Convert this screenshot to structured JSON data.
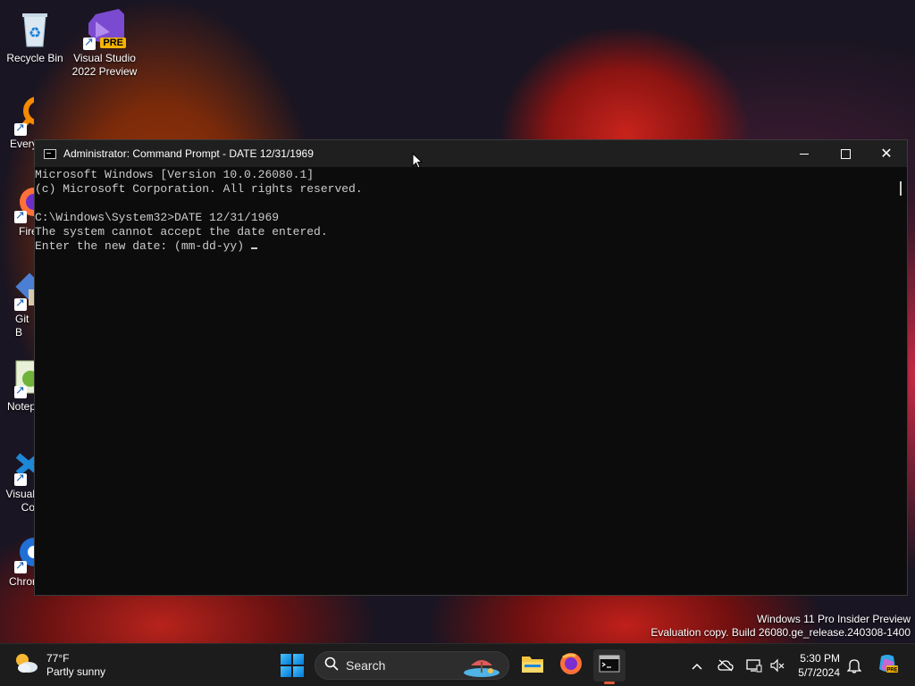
{
  "desktop": {
    "icons": [
      {
        "label": "Recycle Bin"
      },
      {
        "label": "Visual Studio 2022 Preview",
        "badge": "PRE"
      },
      {
        "label": "Every"
      },
      {
        "label": "Fire"
      },
      {
        "label": "Git B"
      },
      {
        "label": "Notep"
      },
      {
        "label": "Visual\nCo"
      },
      {
        "label": "Chrom"
      }
    ]
  },
  "window": {
    "title": "Administrator: Command Prompt - DATE  12/31/1969",
    "icon": "console-icon",
    "lines": [
      "Microsoft Windows [Version 10.0.26080.1]",
      "(c) Microsoft Corporation. All rights reserved.",
      "",
      "C:\\Windows\\System32>DATE 12/31/1969",
      "The system cannot accept the date entered.",
      "Enter the new date: (mm-dd-yy)"
    ]
  },
  "watermark": {
    "line1": "Windows 11 Pro Insider Preview",
    "line2": "Evaluation copy. Build 26080.ge_release.240308-1400"
  },
  "taskbar": {
    "weather": {
      "temp": "77°F",
      "condition": "Partly sunny",
      "icon": "partly-sunny-icon"
    },
    "search": {
      "label": "Search"
    },
    "apps": [
      {
        "name": "File Explorer",
        "icon": "folder-icon"
      },
      {
        "name": "Firefox",
        "icon": "firefox-icon"
      },
      {
        "name": "Terminal",
        "icon": "terminal-icon",
        "active": true
      }
    ],
    "clock": {
      "time": "5:30 PM",
      "date": "5/7/2024"
    }
  },
  "colors": {
    "console_bg": "#0c0c0c",
    "console_text": "#cccccc",
    "titlebar": "#1f1f1f",
    "taskbar": "#1c1c1c",
    "accent": "#0078d4"
  }
}
